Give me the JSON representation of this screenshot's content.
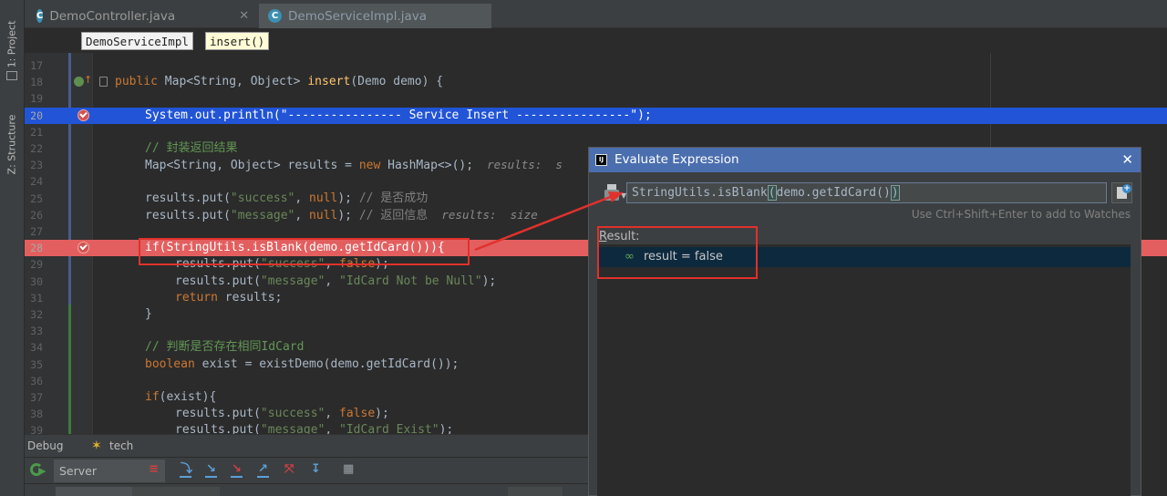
{
  "left_strip": {
    "project_tab": "1: Project",
    "structure_tab": "Z: Structure"
  },
  "tabs": [
    {
      "label": "DemoController.java",
      "icon": "class-icon",
      "active": false
    },
    {
      "label": "DemoServiceImpl.java",
      "icon": "class-icon",
      "active": true
    }
  ],
  "breadcrumb": {
    "class": "DemoServiceImpl",
    "method": "insert()"
  },
  "editor": {
    "lines": [
      {
        "n": "17",
        "code": ""
      },
      {
        "n": "18",
        "code": "public Map<String, Object> insert(Demo demo) {"
      },
      {
        "n": "19",
        "code": ""
      },
      {
        "n": "20",
        "code": "System.out.println(\"---------------- Service Insert ----------------\");"
      },
      {
        "n": "21",
        "code": ""
      },
      {
        "n": "22",
        "code": "// 封装返回结果"
      },
      {
        "n": "23",
        "code": "Map<String, Object> results = new HashMap<>();",
        "hint": "results:  s"
      },
      {
        "n": "24",
        "code": ""
      },
      {
        "n": "25",
        "code": "results.put(\"success\", null); // 是否成功"
      },
      {
        "n": "26",
        "code": "results.put(\"message\", null); // 返回信息",
        "hint": "results:  size"
      },
      {
        "n": "27",
        "code": ""
      },
      {
        "n": "28",
        "code": "if(StringUtils.isBlank(demo.getIdCard())){"
      },
      {
        "n": "29",
        "code": "results.put(\"success\", false);"
      },
      {
        "n": "30",
        "code": "results.put(\"message\", \"IdCard Not be Null\");"
      },
      {
        "n": "31",
        "code": "return results;"
      },
      {
        "n": "32",
        "code": "}"
      },
      {
        "n": "33",
        "code": ""
      },
      {
        "n": "34",
        "code": "// 判断是否存在相同IdCard"
      },
      {
        "n": "35",
        "code": "boolean exist = existDemo(demo.getIdCard());"
      },
      {
        "n": "36",
        "code": ""
      },
      {
        "n": "37",
        "code": "if(exist){"
      },
      {
        "n": "38",
        "code": "results.put(\"success\", false);"
      },
      {
        "n": "39",
        "code": "results.put(\"message\", \"IdCard Exist\");"
      }
    ]
  },
  "dialog": {
    "title": "Evaluate Expression",
    "app_icon": "IJ",
    "close": "✕",
    "expression": "StringUtils.isBlank(demo.getIdCard())",
    "expr_prefix": "StringUtils.isBlank",
    "expr_paren_open": "(",
    "expr_inner": "demo.getIdCard()",
    "expr_paren_close": ")",
    "watch_hint": "Use Ctrl+Shift+Enter to add to Watches",
    "result_label": "Result:",
    "result_text": "result = false",
    "result_icon": "∞"
  },
  "debug": {
    "title": "Debug",
    "config": "tech",
    "server_tab": "Server"
  },
  "colors": {
    "exec_line": "#2154d6",
    "breakpoint_line": "#e35f5f",
    "annotation_red": "#e0312c",
    "dialog_title": "#4b6eaf"
  }
}
